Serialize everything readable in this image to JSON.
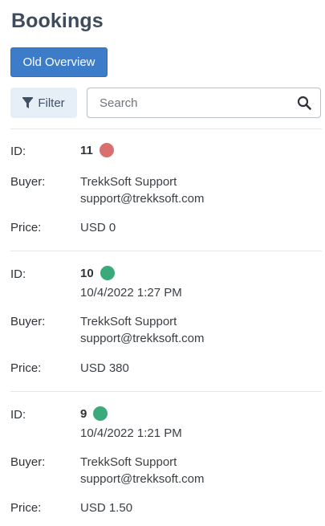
{
  "page": {
    "title": "Bookings"
  },
  "toolbar": {
    "old_overview_label": "Old Overview",
    "filter_label": "Filter",
    "search_placeholder": "Search"
  },
  "labels": {
    "id": "ID:",
    "buyer": "Buyer:",
    "price": "Price:"
  },
  "colors": {
    "status_red": "#d9706f",
    "status_green": "#3aaa7b",
    "button_blue": "#3d7cc9"
  },
  "bookings": [
    {
      "id": "11",
      "date": "",
      "status": "red",
      "buyer_name": "TrekkSoft Support",
      "buyer_email": "support@trekksoft.com",
      "price": "USD 0"
    },
    {
      "id": "10",
      "date": "10/4/2022 1:27 PM",
      "status": "green",
      "buyer_name": "TrekkSoft Support",
      "buyer_email": "support@trekksoft.com",
      "price": "USD 380"
    },
    {
      "id": "9",
      "date": "10/4/2022 1:21 PM",
      "status": "green",
      "buyer_name": "TrekkSoft Support",
      "buyer_email": "support@trekksoft.com",
      "price": "USD 1.50"
    }
  ]
}
